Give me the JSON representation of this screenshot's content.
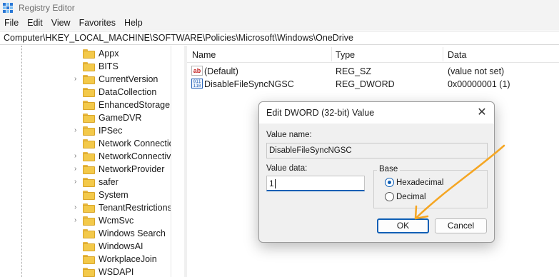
{
  "window": {
    "title": "Registry Editor"
  },
  "menu": [
    "File",
    "Edit",
    "View",
    "Favorites",
    "Help"
  ],
  "address": "Computer\\HKEY_LOCAL_MACHINE\\SOFTWARE\\Policies\\Microsoft\\Windows\\OneDrive",
  "tree": [
    {
      "label": "Appx",
      "expandable": false
    },
    {
      "label": "BITS",
      "expandable": false
    },
    {
      "label": "CurrentVersion",
      "expandable": true
    },
    {
      "label": "DataCollection",
      "expandable": false
    },
    {
      "label": "EnhancedStorageD",
      "expandable": false
    },
    {
      "label": "GameDVR",
      "expandable": false
    },
    {
      "label": "IPSec",
      "expandable": true
    },
    {
      "label": "Network Connectio",
      "expandable": false
    },
    {
      "label": "NetworkConnectiv",
      "expandable": true
    },
    {
      "label": "NetworkProvider",
      "expandable": true
    },
    {
      "label": "safer",
      "expandable": true
    },
    {
      "label": "System",
      "expandable": false
    },
    {
      "label": "TenantRestrictions",
      "expandable": true
    },
    {
      "label": "WcmSvc",
      "expandable": true
    },
    {
      "label": "Windows Search",
      "expandable": false
    },
    {
      "label": "WindowsAI",
      "expandable": false
    },
    {
      "label": "WorkplaceJoin",
      "expandable": false
    },
    {
      "label": "WSDAPI",
      "expandable": false
    }
  ],
  "columns": {
    "name": "Name",
    "type": "Type",
    "data": "Data"
  },
  "values": [
    {
      "name": "(Default)",
      "type": "REG_SZ",
      "data": "(value not set)",
      "icon": "string-value-icon"
    },
    {
      "name": "DisableFileSyncNGSC",
      "type": "REG_DWORD",
      "data": "0x00000001 (1)",
      "icon": "dword-value-icon"
    }
  ],
  "dialog": {
    "title": "Edit DWORD (32-bit) Value",
    "value_name_label": "Value name:",
    "value_name": "DisableFileSyncNGSC",
    "value_data_label": "Value data:",
    "value_data": "1",
    "base_label": "Base",
    "hex_label": "Hexadecimal",
    "dec_label": "Decimal",
    "base_selected": "Hexadecimal",
    "ok_label": "OK",
    "cancel_label": "Cancel"
  },
  "colors": {
    "accent": "#0f5fb5",
    "folder": "#f3c94a",
    "annotation_arrow": "#f5a623"
  }
}
